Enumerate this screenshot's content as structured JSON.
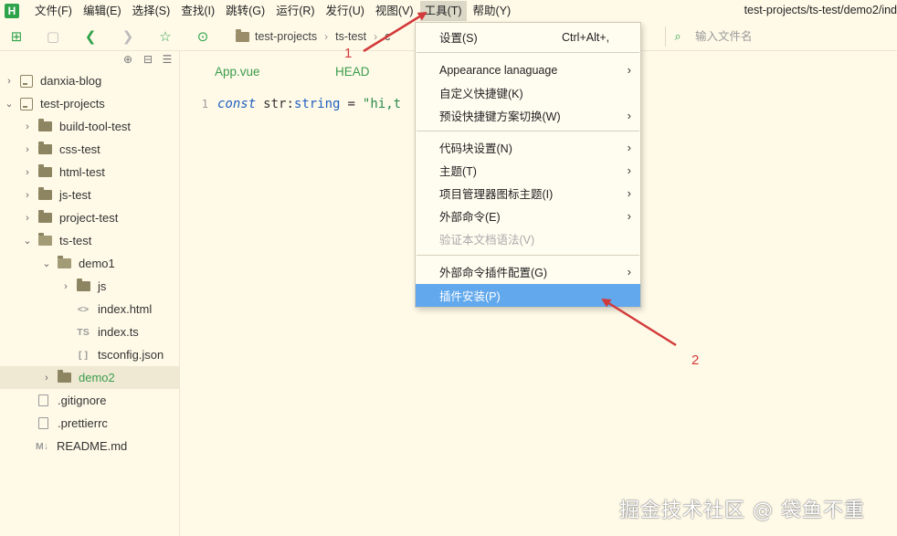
{
  "app": {
    "logo": "H",
    "window_title": "test-projects/ts-test/demo2/ind"
  },
  "menubar": {
    "items": [
      {
        "label": "文件(F)"
      },
      {
        "label": "编辑(E)"
      },
      {
        "label": "选择(S)"
      },
      {
        "label": "查找(I)"
      },
      {
        "label": "跳转(G)"
      },
      {
        "label": "运行(R)"
      },
      {
        "label": "发行(U)"
      },
      {
        "label": "视图(V)"
      },
      {
        "label": "工具(T)"
      },
      {
        "label": "帮助(Y)"
      }
    ]
  },
  "toolbar": {
    "breadcrumb": [
      "test-projects",
      "ts-test",
      "c"
    ],
    "search_placeholder": "输入文件名"
  },
  "sidebar": {
    "tree": [
      {
        "label": "danxia-blog"
      },
      {
        "label": "test-projects"
      },
      {
        "label": "build-tool-test"
      },
      {
        "label": "css-test"
      },
      {
        "label": "html-test"
      },
      {
        "label": "js-test"
      },
      {
        "label": "project-test"
      },
      {
        "label": "ts-test"
      },
      {
        "label": "demo1"
      },
      {
        "label": "js"
      },
      {
        "label": "index.html",
        "icon_text": "<>"
      },
      {
        "label": "index.ts",
        "icon_text": "TS"
      },
      {
        "label": "tsconfig.json",
        "icon_text": "[ ]"
      },
      {
        "label": "demo2"
      },
      {
        "label": ".gitignore"
      },
      {
        "label": ".prettierrc"
      },
      {
        "label": "README.md",
        "icon_text": "M↓"
      }
    ]
  },
  "editor": {
    "tabs": [
      {
        "label": "App.vue"
      },
      {
        "label": "HEAD"
      }
    ],
    "line_number": "1",
    "code": {
      "kw": "const",
      "name": "str",
      "colon": ":",
      "type": "string",
      "eq": "=",
      "str": "\"hi,t"
    }
  },
  "dropdown": {
    "items": [
      {
        "label": "设置(S)",
        "shortcut": "Ctrl+Alt+,"
      },
      {
        "label": "Appearance lanaguage"
      },
      {
        "label": "自定义快捷键(K)"
      },
      {
        "label": "预设快捷键方案切换(W)"
      },
      {
        "label": "代码块设置(N)"
      },
      {
        "label": "主题(T)"
      },
      {
        "label": "项目管理器图标主题(I)"
      },
      {
        "label": "外部命令(E)"
      },
      {
        "label": "验证本文档语法(V)"
      },
      {
        "label": "外部命令插件配置(G)"
      },
      {
        "label": "插件安装(P)"
      }
    ]
  },
  "annotations": {
    "label_1": "1",
    "label_2": "2",
    "watermark": "掘金技术社区 @ 袋鱼不重",
    "color": "#d23a3a"
  }
}
